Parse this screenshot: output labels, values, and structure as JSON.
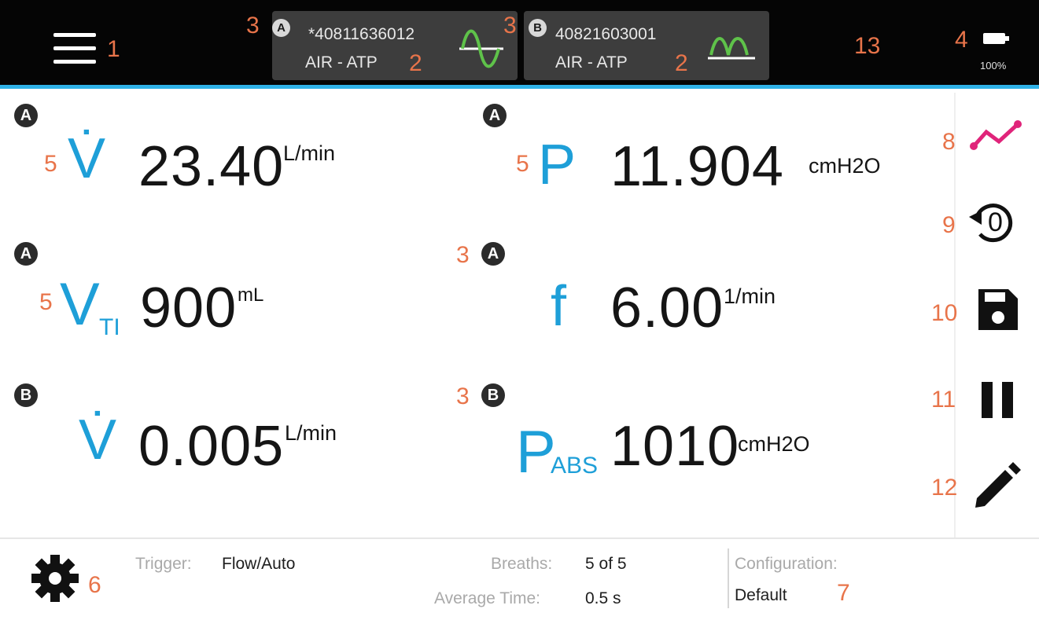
{
  "header": {
    "menu_icon": "hamburger-menu-icon",
    "sensor_a": {
      "badge": "A",
      "serial": "*40811636012",
      "mode": "AIR - ATP",
      "wave_color": "#5fc24a"
    },
    "sensor_b": {
      "badge": "B",
      "serial": "40821603001",
      "mode": "AIR - ATP",
      "wave_color": "#5fc24a"
    },
    "battery": {
      "icon": "battery-icon",
      "level_text": "100%",
      "level": 1.0
    }
  },
  "callouts": {
    "c1": "1",
    "c2a": "2",
    "c2b": "2",
    "c3a": "3",
    "c3b": "3",
    "c3c": "3",
    "c3d": "3",
    "c4": "4",
    "c5a": "5",
    "c5b": "5",
    "c5c": "5",
    "c6": "6",
    "c7": "7",
    "c8": "8",
    "c9": "9",
    "c10": "10",
    "c11": "11",
    "c12": "12",
    "c13": "13"
  },
  "readings": [
    {
      "channel": "A",
      "symbol": "V̇",
      "sub": "",
      "value": "23.40",
      "unit": "L/min"
    },
    {
      "channel": "A",
      "symbol": "P",
      "sub": "",
      "value": "11.904",
      "unit": "cmH2O"
    },
    {
      "channel": "A",
      "symbol": "V",
      "sub": "TI",
      "value": "900",
      "unit": "mL"
    },
    {
      "channel": "A",
      "symbol": "f",
      "sub": "",
      "value": "6.00",
      "unit": "1/min"
    },
    {
      "channel": "B",
      "symbol": "V̇",
      "sub": "",
      "value": "0.005",
      "unit": "L/min"
    },
    {
      "channel": "B",
      "symbol": "P",
      "sub": "ABS",
      "value": "1010",
      "unit": "cmH2O"
    }
  ],
  "side_buttons": {
    "chart": "chart-line-icon",
    "zero": "zero-reset-icon",
    "zero_text": "0",
    "save": "save-icon",
    "pause": "pause-icon",
    "edit": "pencil-edit-icon",
    "chart_color": "#e0247a"
  },
  "footer": {
    "settings_icon": "gear-icon",
    "trigger_label": "Trigger:",
    "trigger_value": "Flow/Auto",
    "breaths_label": "Breaths:",
    "breaths_value": "5 of 5",
    "avg_label": "Average Time:",
    "avg_value": "0.5 s",
    "config_label": "Configuration:",
    "config_value": "Default"
  },
  "colors": {
    "accent": "#1e9fd8",
    "callout": "#e8744a",
    "topbar": "#050505"
  }
}
